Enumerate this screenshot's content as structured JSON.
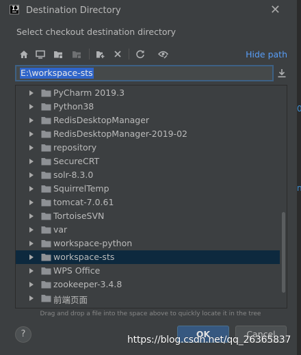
{
  "window": {
    "title": "Destination Directory",
    "app_icon_letters": "IJ"
  },
  "subtitle": "Select checkout destination directory",
  "toolbar": {
    "icons": [
      "home-icon",
      "desktop-icon",
      "project-folder-icon",
      "module-folder-icon",
      "new-folder-icon",
      "delete-icon",
      "refresh-icon",
      "show-hidden-icon"
    ],
    "hide_path_label": "Hide path"
  },
  "path_field": {
    "value": "E:\\workspace-sts"
  },
  "tree": {
    "items": [
      "PyCharm 2019.3",
      "Python38",
      "RedisDesktopManager",
      "RedisDesktopManager-2019-02",
      "repository",
      "SecureCRT",
      "solr-8.3.0",
      "SquirrelTemp",
      "tomcat-7.0.61",
      "TortoiseSVN",
      "var",
      "workspace-python",
      "workspace-sts",
      "WPS Office",
      "zookeeper-3.4.8",
      "前端页面"
    ],
    "selected": "workspace-sts"
  },
  "hint": "Drag and drop a file into the space above to quickly locate it in the tree",
  "footer": {
    "help_label": "?",
    "ok_label": "OK",
    "cancel_label": "Cancel"
  },
  "watermark": "https://blog.csdn.net/qq_26365837",
  "colors": {
    "accent": "#589df6",
    "selection": "#0d293e",
    "text_selection": "#2f65ca",
    "ok_button": "#365880",
    "folder": "#8e9195"
  }
}
